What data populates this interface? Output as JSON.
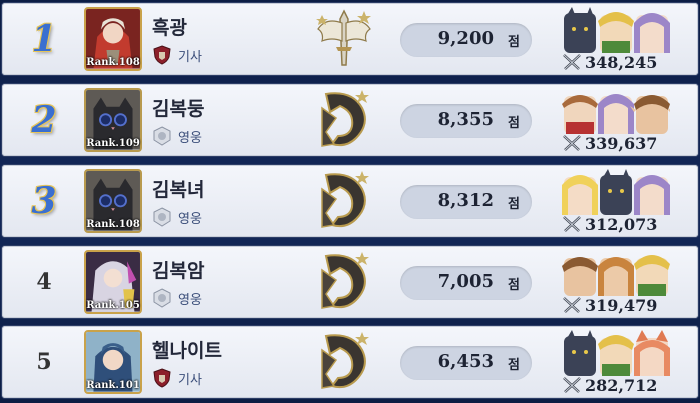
{
  "score_unit": "점",
  "rank_prefix": "Rank.",
  "rows": [
    {
      "rank": "1",
      "rank_style": "top",
      "avatar": "red-knight",
      "level": "108",
      "name": "흑광",
      "title_icon": "knight",
      "title": "기사",
      "emblem": "winged-sword",
      "score": "9,200",
      "party": [
        "wolf",
        "ranger",
        "mage"
      ],
      "power": "348,245"
    },
    {
      "rank": "2",
      "rank_style": "top",
      "avatar": "black-cat",
      "level": "109",
      "name": "김복둥",
      "title_icon": "hero",
      "title": "영웅",
      "emblem": "dragon",
      "score": "8,355",
      "party": [
        "warrior",
        "mage",
        "elf"
      ],
      "power": "339,637"
    },
    {
      "rank": "3",
      "rank_style": "top",
      "avatar": "black-cat",
      "level": "108",
      "name": "김복녀",
      "title_icon": "hero",
      "title": "영웅",
      "emblem": "dragon",
      "score": "8,312",
      "party": [
        "priestess",
        "wolf",
        "mage"
      ],
      "power": "312,073"
    },
    {
      "rank": "4",
      "rank_style": "plain",
      "avatar": "silver-girl",
      "level": "105",
      "name": "김복암",
      "title_icon": "hero",
      "title": "영웅",
      "emblem": "dragon",
      "score": "7,005",
      "party": [
        "elf",
        "elf2",
        "ranger"
      ],
      "power": "319,479"
    },
    {
      "rank": "5",
      "rank_style": "plain",
      "avatar": "blue-boy",
      "level": "101",
      "name": "헬나이트",
      "title_icon": "knight",
      "title": "기사",
      "emblem": "dragon",
      "score": "6,453",
      "party": [
        "wolf",
        "ranger",
        "fox"
      ],
      "power": "282,712"
    }
  ]
}
